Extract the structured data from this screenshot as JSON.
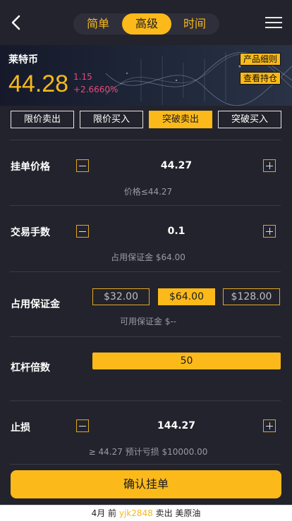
{
  "header": {
    "tabs": [
      "简单",
      "高级",
      "时间"
    ],
    "active_tab": 1
  },
  "banner": {
    "name": "莱特币",
    "price": "44.28",
    "change_value": "1.15",
    "change_percent": "+2.6660%",
    "buttons": [
      "产品细则",
      "查看持仓"
    ]
  },
  "order_types": [
    "限价卖出",
    "限价买入",
    "突破卖出",
    "突破买入"
  ],
  "active_order_type": 2,
  "order_price": {
    "label": "挂单价格",
    "value": "44.27",
    "hint": "价格≤44.27"
  },
  "lots": {
    "label": "交易手数",
    "value": "0.1",
    "hint": "占用保证金 $64.00"
  },
  "margin": {
    "label": "占用保证金",
    "options": [
      "$32.00",
      "$64.00",
      "$128.00"
    ],
    "active": 1,
    "hint": "可用保证金 $--"
  },
  "leverage": {
    "label": "杠杆倍数",
    "value": "50"
  },
  "stop_loss": {
    "label": "止损",
    "value": "144.27",
    "hint": "≥ 44.27 预计亏损 $10000.00"
  },
  "confirm_label": "确认挂单",
  "ticker": {
    "prefix": "4月 前 ",
    "user": "yjk2848",
    "suffix": " 卖出 美原油"
  },
  "colors": {
    "accent": "#fbba1a",
    "background": "#23232d",
    "down": "#e44a7c"
  }
}
